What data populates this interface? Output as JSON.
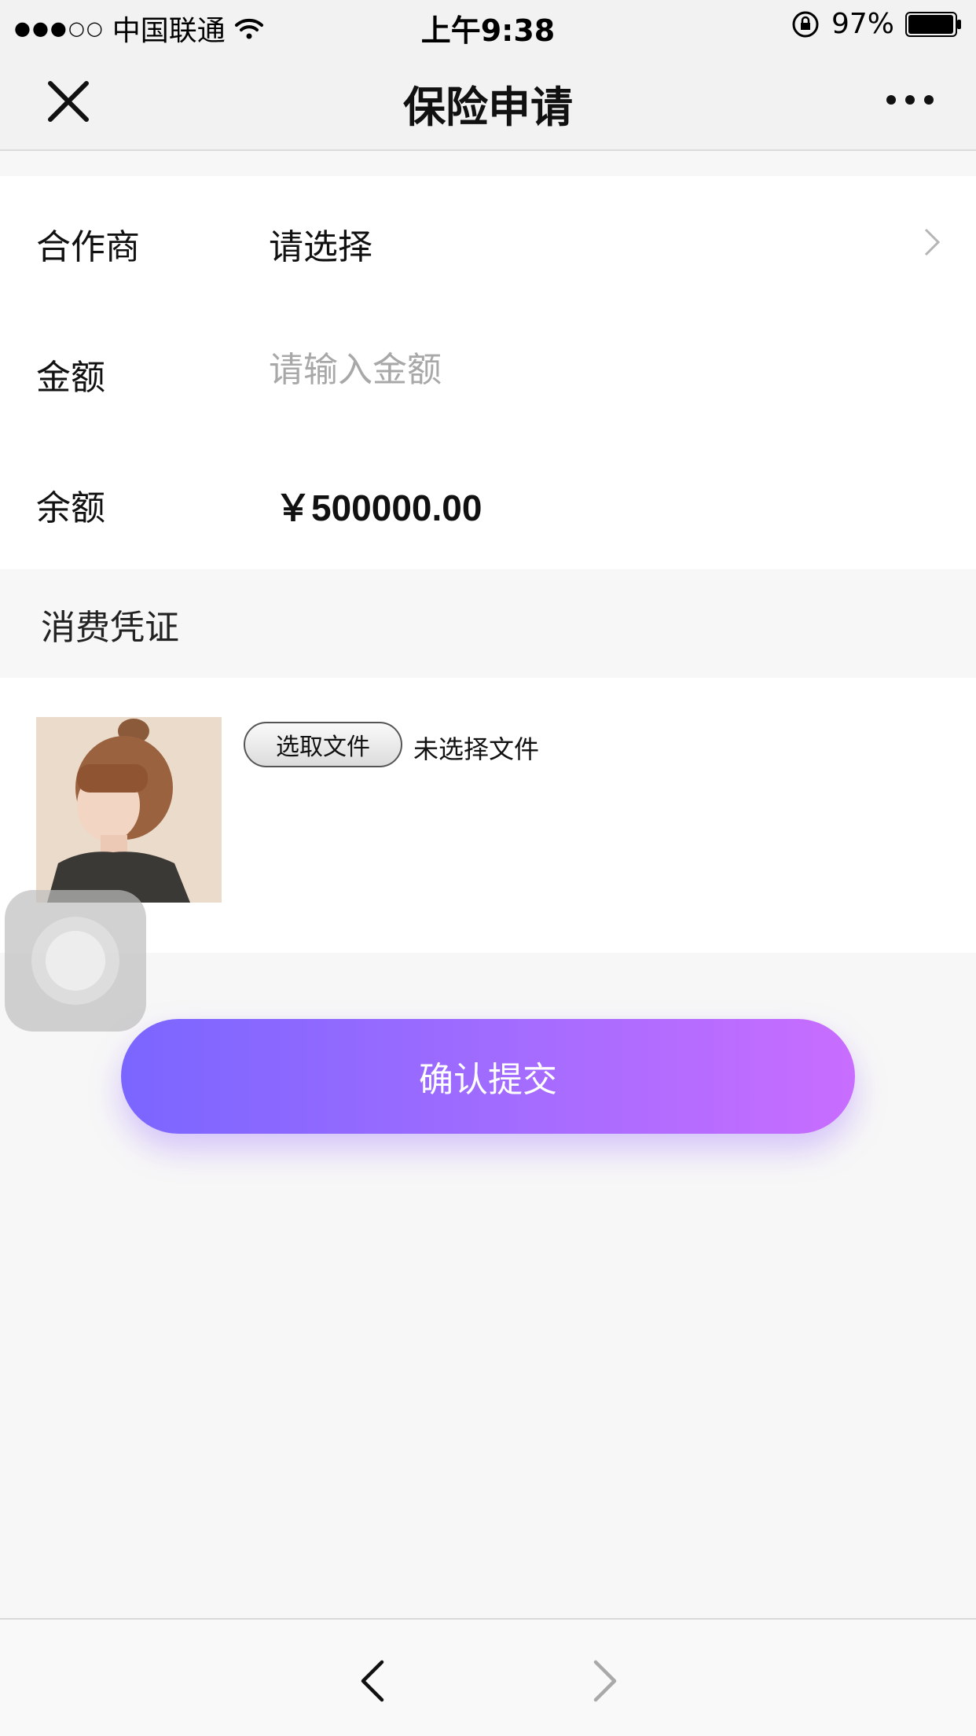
{
  "status_bar": {
    "signal": "●●●○○",
    "carrier": "中国联通",
    "time": "上午9:38",
    "battery": "97%"
  },
  "nav": {
    "title": "保险申请",
    "close_icon": "close-icon",
    "more_icon": "more-icon"
  },
  "form": {
    "partner_label": "合作商",
    "partner_value": "请选择",
    "amount_label": "金额",
    "amount_placeholder": "请输入金额",
    "amount_value": "",
    "balance_label": "余额",
    "balance_value": "￥500000.00"
  },
  "voucher": {
    "section_title": "消费凭证",
    "file_button_label": "选取文件",
    "file_status": "未选择文件"
  },
  "submit_label": "确认提交",
  "colors": {
    "accent_start": "#7a66ff",
    "accent_end": "#c86dff",
    "background": "#f7f7f7"
  }
}
